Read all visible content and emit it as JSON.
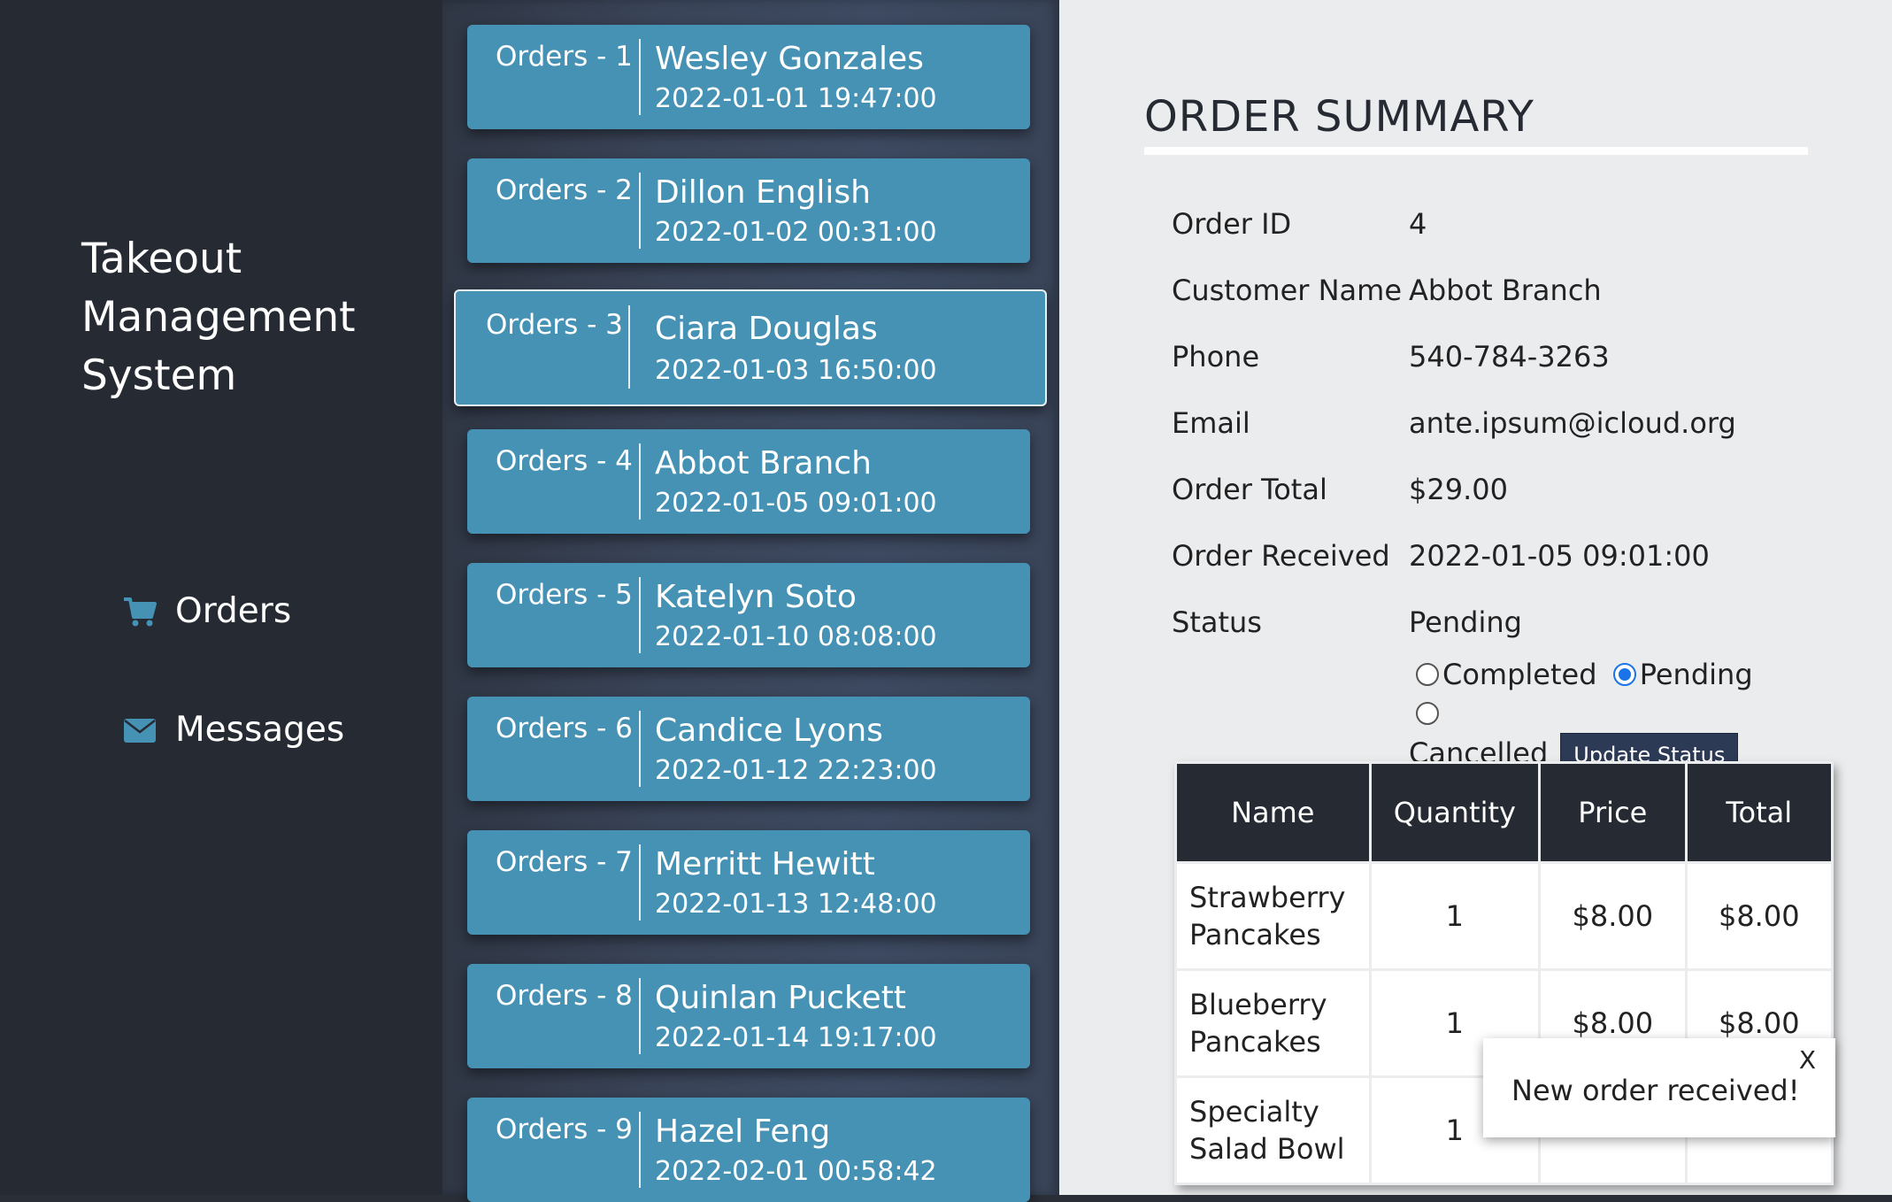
{
  "app": {
    "title_lines": [
      "Takeout",
      "Management",
      "System"
    ]
  },
  "nav": {
    "orders_label": "Orders",
    "orders_icon": "cart-icon",
    "messages_label": "Messages",
    "messages_icon": "envelope-icon",
    "icon_color": "#4592b5"
  },
  "orders": [
    {
      "label": "Orders - 1",
      "name": "Wesley Gonzales",
      "date": "2022-01-01 19:47:00"
    },
    {
      "label": "Orders - 2",
      "name": "Dillon English",
      "date": "2022-01-02 00:31:00"
    },
    {
      "label": "Orders - 3",
      "name": "Ciara Douglas",
      "date": "2022-01-03 16:50:00"
    },
    {
      "label": "Orders - 4",
      "name": "Abbot Branch",
      "date": "2022-01-05 09:01:00"
    },
    {
      "label": "Orders - 5",
      "name": "Katelyn Soto",
      "date": "2022-01-10 08:08:00"
    },
    {
      "label": "Orders - 6",
      "name": "Candice Lyons",
      "date": "2022-01-12 22:23:00"
    },
    {
      "label": "Orders - 7",
      "name": "Merritt Hewitt",
      "date": "2022-01-13 12:48:00"
    },
    {
      "label": "Orders - 8",
      "name": "Quinlan Puckett",
      "date": "2022-01-14 19:17:00"
    },
    {
      "label": "Orders - 9",
      "name": "Hazel Feng",
      "date": "2022-02-01 00:58:42"
    }
  ],
  "summary": {
    "title": "ORDER SUMMARY",
    "fields": [
      {
        "label": "Order ID",
        "value": "4"
      },
      {
        "label": "Customer Name",
        "value": "Abbot Branch"
      },
      {
        "label": "Phone",
        "value": "540-784-3263"
      },
      {
        "label": "Email",
        "value": "ante.ipsum@icloud.org"
      },
      {
        "label": "Order Total",
        "value": "$29.00"
      },
      {
        "label": "Order Received",
        "value": "2022-01-05 09:01:00"
      },
      {
        "label": "Status",
        "value": "Pending"
      }
    ],
    "status_options": {
      "completed": "Completed",
      "pending": "Pending",
      "cancelled": "Cancelled",
      "selected": "Pending"
    },
    "update_button": "Update Status"
  },
  "items_table": {
    "headers": [
      "Name",
      "Quantity",
      "Price",
      "Total"
    ],
    "rows": [
      {
        "name": "Strawberry Pancakes",
        "quantity": "1",
        "price": "$8.00",
        "total": "$8.00"
      },
      {
        "name": "Blueberry Pancakes",
        "quantity": "1",
        "price": "$8.00",
        "total": "$8.00"
      },
      {
        "name": "Specialty Salad Bowl",
        "quantity": "1",
        "price": "",
        "total": ""
      }
    ]
  },
  "toast": {
    "message": "New order received!",
    "close_label": "X"
  }
}
